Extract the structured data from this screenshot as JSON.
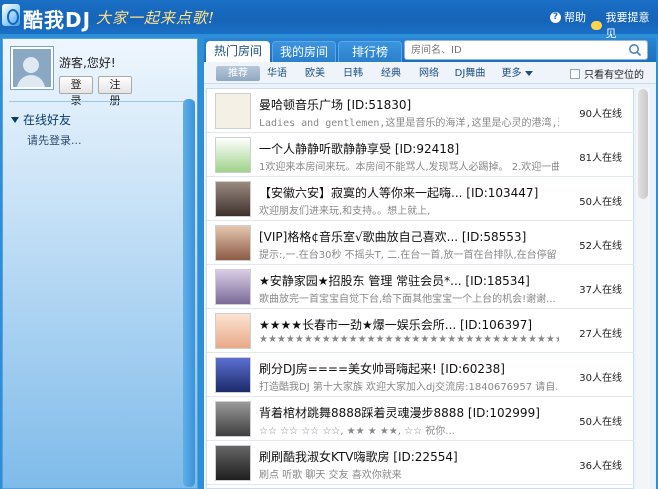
{
  "app": {
    "title": "酷我DJ",
    "slogan": "大家一起来点歌!",
    "help_label": "帮助",
    "feedback_label": "我要提意见"
  },
  "user": {
    "greeting": "游客,您好!",
    "login_label": "登录",
    "register_label": "注册"
  },
  "friends": {
    "title": "在线好友",
    "prompt": "请先登录..."
  },
  "tabs": [
    {
      "label": "热门房间",
      "active": true
    },
    {
      "label": "我的房间",
      "active": false
    },
    {
      "label": "排行榜",
      "active": false
    }
  ],
  "search": {
    "placeholder": "房间名、ID"
  },
  "filters": {
    "items": [
      "推荐",
      "华语",
      "欧美",
      "日韩",
      "经典",
      "网络",
      "DJ舞曲",
      "更多"
    ],
    "only_free_label": "只看有空位的"
  },
  "rooms": [
    {
      "title": "曼哈顿音乐广场 [ID:51830]",
      "desc": "Ladies and gentlemen,这里是音乐的海洋,这里是心灵的港湾,这...",
      "online": "90人在线",
      "thumb_color": "#e9d2a8"
    },
    {
      "title": "一个人静静听歌静静享受 [ID:92418]",
      "desc": "1欢迎来本房间来玩。本房间不能骂人,发现骂人必踢掉。 2.欢迎一曲...",
      "online": "81人在线",
      "thumb_color": "#7cc36a"
    },
    {
      "title": "【安徽六安】寂寞的人等你来一起嗨... [ID:103447]",
      "desc": "欢迎朋友们进来玩,和支持。。想上就上,",
      "online": "50人在线",
      "thumb_color": "#6a5a55"
    },
    {
      "title": "[VIP]格格¢音乐室√歌曲放自己喜欢... [ID:58553]",
      "desc": "提示:,一.在台30秒   不摇头T, 二.在台一首,放一首在台排队,在台停留",
      "online": "52人在线",
      "thumb_color": "#c08a6c"
    },
    {
      "title": "★安静家园★招股东 管理 常驻会员*... [ID:18534]",
      "desc": "歌曲放完一首宝宝自觉下台,给下面其他宝宝一个上台的机会!谢谢...",
      "online": "37人在线",
      "thumb_color": "#8a7aa6"
    },
    {
      "title": "★★★★长春市一劲★爆一娱乐会所... [ID:106397]",
      "desc": "★★★★★★★★★★★★★★★★★★★★★★★★★★★★★★★★★★★★",
      "online": "27人在线",
      "thumb_color": "#f1c7a8"
    },
    {
      "title": "刷分DJ房====美女帅哥嗨起来! [ID:60238]",
      "desc": "打造酷我DJ 第十大家族 欢迎大家加入dj交流房:1840676957 请自...",
      "online": "30人在线",
      "thumb_color": "#3a4a8a"
    },
    {
      "title": "背着棺材跳舞8888踩着灵魂漫步8888 [ID:102999]",
      "desc": "☆☆ ☆☆   ☆☆ ☆☆,  ★★      ★       ★★, ☆☆    祝你...",
      "online": "50人在线",
      "thumb_color": "#5a5a5a"
    },
    {
      "title": "刷刷酷我淑女KTV嗨歌房 [ID:22554]",
      "desc": "刷点   听歌   聊天   交友   喜欢你就来",
      "online": "36人在线",
      "thumb_color": "#2d2d2d"
    }
  ]
}
